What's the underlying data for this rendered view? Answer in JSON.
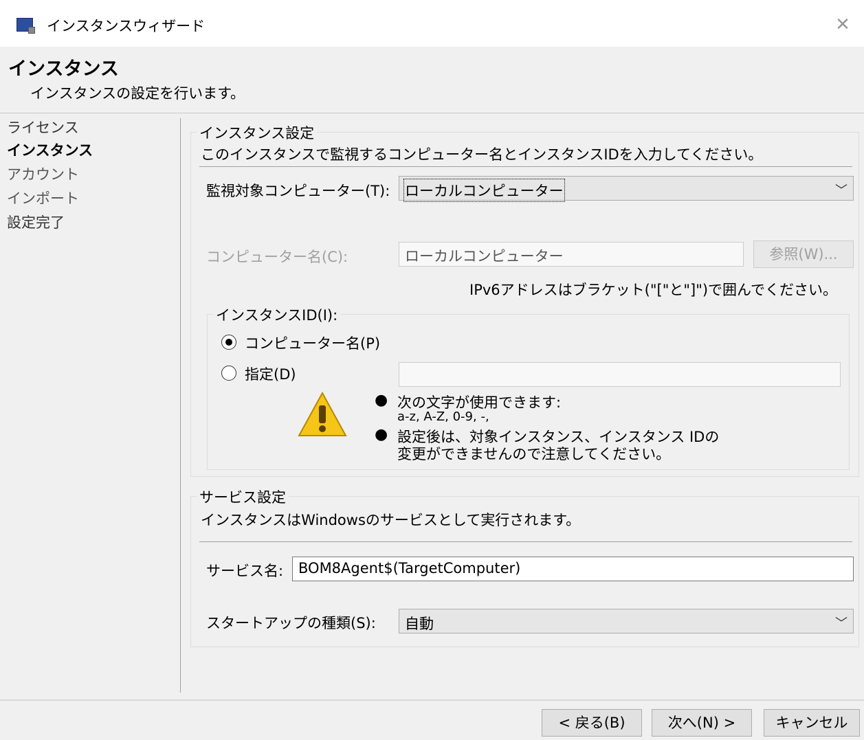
{
  "window": {
    "title": "インスタンスウィザード",
    "close_glyph": "✕"
  },
  "header": {
    "title": "インスタンス",
    "subtitle": "インスタンスの設定を行います。"
  },
  "nav": {
    "items": [
      {
        "label": "ライセンス",
        "state": "done"
      },
      {
        "label": "インスタンス",
        "state": "active"
      },
      {
        "label": "アカウント",
        "state": "pending"
      },
      {
        "label": "インポート",
        "state": "pending"
      },
      {
        "label": "設定完了",
        "state": "done"
      }
    ]
  },
  "instance_settings": {
    "legend": "インスタンス設定",
    "description": "このインスタンスで監視するコンピューター名とインスタンスIDを入力してください。",
    "target_label": "監視対象コンピューター(T):",
    "target_value": "ローカルコンピューター",
    "computer_name_label": "コンピューター名(C):",
    "computer_name_value": "ローカルコンピューター",
    "browse_label": "参照(W)...",
    "ipv6_note": "IPv6アドレスはブラケット(\"[\"と\"]\")で囲んでください。",
    "instance_id": {
      "legend": "インスタンスID(I):",
      "option_computer": "コンピューター名(P)",
      "option_custom": "指定(D)",
      "selected": "computer",
      "custom_value": "",
      "note1_title": "次の文字が使用できます:",
      "note1_detail": "a-z, A-Z, 0-9, -,",
      "note2_line1": "設定後は、対象インスタンス、インスタンス IDの",
      "note2_line2": "変更ができませんので注意してください。",
      "bullet": "●"
    }
  },
  "service_settings": {
    "legend": "サービス設定",
    "description": "インスタンスはWindowsのサービスとして実行されます。",
    "service_name_label": "サービス名:",
    "service_name_value": "BOM8Agent$(TargetComputer)",
    "startup_label": "スタートアップの種類(S):",
    "startup_value": "自動"
  },
  "footer": {
    "back_label": "< 戻る(B)",
    "next_label": "次へ(N) >",
    "cancel_label": "キャンセル"
  },
  "colors": {
    "background": "#f0f0f0",
    "disabled_text": "#a0a0a0",
    "warning": "#f5c518"
  }
}
